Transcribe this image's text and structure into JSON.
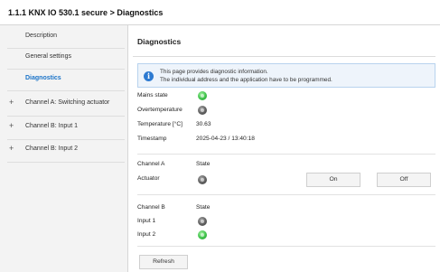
{
  "window": {
    "title": "1.1.1 KNX IO 530.1 secure > Diagnostics"
  },
  "sidebar": {
    "items": [
      {
        "label": "Description",
        "expandable": false,
        "active": false
      },
      {
        "label": "General settings",
        "expandable": false,
        "active": false
      },
      {
        "label": "Diagnostics",
        "expandable": false,
        "active": true
      },
      {
        "label": "Channel A: Switching actuator",
        "expandable": true,
        "active": false
      },
      {
        "label": "Channel B: Input 1",
        "expandable": true,
        "active": false
      },
      {
        "label": "Channel B: Input 2",
        "expandable": true,
        "active": false
      }
    ],
    "expand_glyph": "+"
  },
  "main": {
    "title": "Diagnostics",
    "info": {
      "icon": "info-icon",
      "line1": "This page provides diagnostic information.",
      "line2": "The individual address and the application have to be programmed."
    },
    "status": {
      "mains_label": "Mains state",
      "mains_led": "green",
      "overtemp_label": "Overtemperature",
      "overtemp_led": "grey",
      "temp_label": "Temperature [°C]",
      "temp_value": "30.63",
      "timestamp_label": "Timestamp",
      "timestamp_value": "2025-04-23 / 13:40:18"
    },
    "channel_a": {
      "header": "Channel A",
      "state_header": "State",
      "actuator_label": "Actuator",
      "actuator_led": "grey",
      "on_label": "On",
      "off_label": "Off"
    },
    "channel_b": {
      "header": "Channel B",
      "state_header": "State",
      "input1_label": "Input 1",
      "input1_led": "grey",
      "input2_label": "Input 2",
      "input2_led": "green"
    },
    "refresh_label": "Refresh"
  },
  "colors": {
    "accent": "#1a73c8",
    "led_on": "#3ec24a",
    "led_off": "#5f5f5f",
    "info_bg": "#eef4fb"
  }
}
